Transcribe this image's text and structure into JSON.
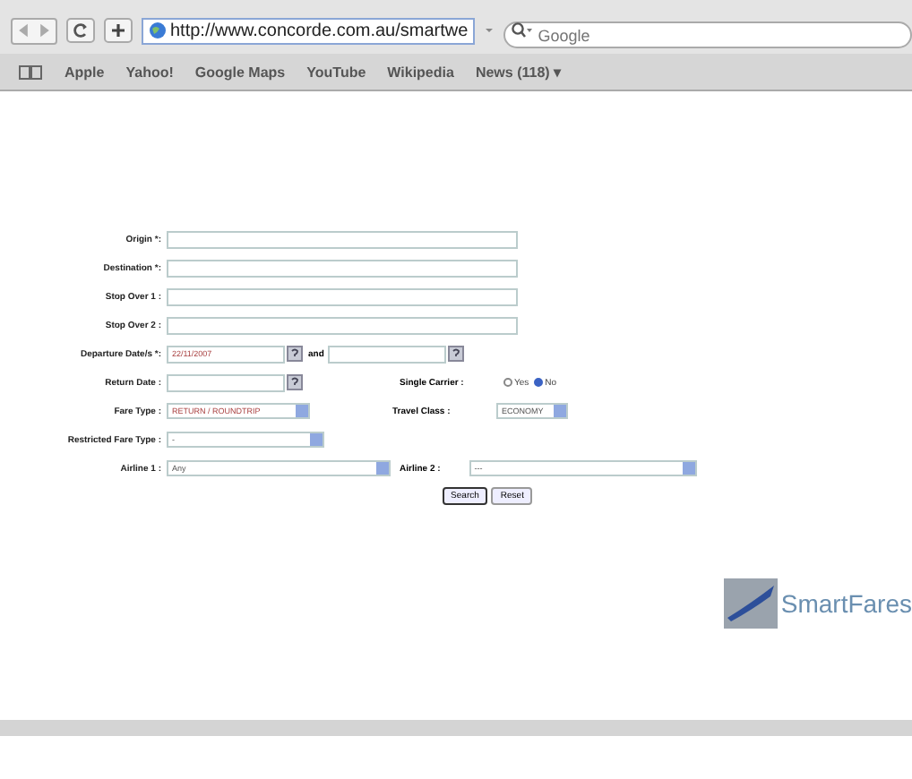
{
  "toolbar": {
    "url": "http://www.concorde.com.au/smartwe",
    "search_placeholder": "Google"
  },
  "bookmarks": [
    {
      "label": "Apple"
    },
    {
      "label": "Yahoo!"
    },
    {
      "label": "Google Maps"
    },
    {
      "label": "YouTube"
    },
    {
      "label": "Wikipedia"
    },
    {
      "label": "News (118) ▾"
    }
  ],
  "form": {
    "origin": {
      "label": "Origin *:"
    },
    "destination": {
      "label": "Destination *:"
    },
    "stop_over_1": {
      "label": "Stop Over 1 :"
    },
    "stop_over_2": {
      "label": "Stop Over 2 :"
    },
    "departure": {
      "label": "Departure Date/s *:",
      "value": "22/11/2007",
      "and": "and"
    },
    "return_date": {
      "label": "Return Date :"
    },
    "single_carrier": {
      "label": "Single Carrier :",
      "options": [
        {
          "label": "Yes",
          "selected": false
        },
        {
          "label": "No",
          "selected": true
        }
      ]
    },
    "fare_type": {
      "label": "Fare Type :",
      "value": "RETURN / ROUNDTRIP"
    },
    "travel_class": {
      "label": "Travel Class :",
      "value": "ECONOMY"
    },
    "restricted_fare_type": {
      "label": "Restricted Fare Type :",
      "value": "-"
    },
    "airline_1": {
      "label": "Airline 1 :",
      "value": "Any"
    },
    "airline_2": {
      "label": "Airline 2 :",
      "value": "---"
    },
    "buttons": [
      "Search",
      "Reset"
    ]
  },
  "logo": {
    "name": "SmartFares"
  }
}
